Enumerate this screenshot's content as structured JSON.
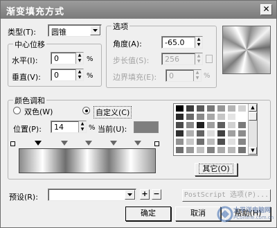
{
  "dialog": {
    "title": "渐变填充方式",
    "close_glyph": "✕"
  },
  "type": {
    "label": "类型(T):",
    "value": "圆锥"
  },
  "center": {
    "group_label": "中心位移",
    "h_label": "水平(I):",
    "h_value": "0",
    "v_label": "垂直(V):",
    "v_value": "0",
    "unit": "%"
  },
  "options": {
    "group_label": "选项",
    "angle_label": "角度(A):",
    "angle_value": "-65.0",
    "steps_label": "步长值(S):",
    "steps_value": "256",
    "edge_label": "边界填充(E):",
    "edge_value": "0",
    "unit": "%"
  },
  "blend": {
    "group_label": "颜色调和",
    "two_color_label": "双色(W)",
    "custom_label": "自定义(C)",
    "selected": "custom",
    "position_label": "位置(P):",
    "position_value": "14",
    "unit": "%",
    "current_label": "当前(U):",
    "current_color": "#7e7e7e",
    "others_label": "其它(O)"
  },
  "palette": {
    "colors": [
      "#000000",
      "#3c3c3c",
      "#5a5a5a",
      "#787878",
      "#969696",
      "#b4b4b4",
      "#d2d2d2",
      "#2a2a2a",
      "#6a6a6a",
      "#8a8a8a",
      "#a8a8a8",
      "#c6c6c6",
      "#e4e4e4",
      "#ffffff",
      "#4a4a4a",
      "#888888",
      "#1e1e1e",
      "#9e9e9e",
      "#5e5e5e",
      "#d0d0d0",
      "#7a7a7a",
      "#303030",
      "#b0b0b0",
      "#646464",
      "#dcdcdc",
      "#404040",
      "#a0a0a0",
      "#8c8c8c",
      "#929292",
      "#c8c8c8",
      "#707070",
      "#bcbcbc",
      "#505050",
      "#e0e0e0",
      "#868686",
      "#6e6e6e",
      "#9a9a9a",
      "#c0c0c0",
      "#828282",
      "#aaaaaa",
      "#b8b8b8",
      "#747474"
    ]
  },
  "preset": {
    "label": "预设(R):",
    "value": "",
    "add_glyph": "+",
    "remove_glyph": "−",
    "postscript_label": "PostScript 选项(P)..."
  },
  "buttons": {
    "ok": "确定",
    "cancel": "取消",
    "help": "帮助(H)"
  },
  "watermark": {
    "text": "太平洋电脑网",
    "url": "PConline.com.cn"
  }
}
